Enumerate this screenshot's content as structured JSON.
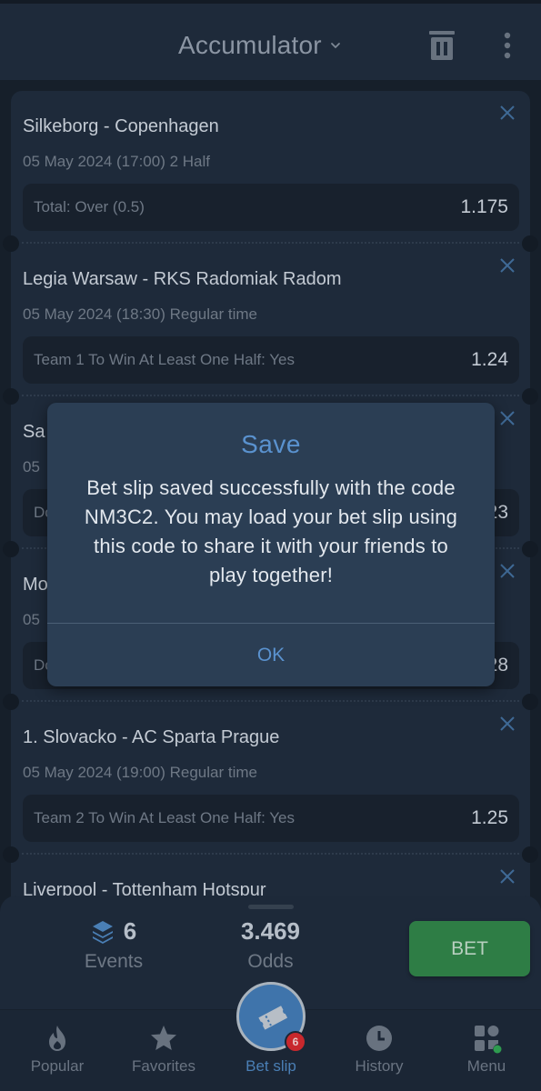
{
  "header": {
    "title": "Accumulator",
    "icons": {
      "dropdown": "chevron-down-icon",
      "delete": "trash-icon",
      "more": "more-vert-icon"
    }
  },
  "bets": [
    {
      "match": "Silkeborg - Copenhagen",
      "date": "05 May 2024 (17:00) 2 Half",
      "market": "Total: Over (0.5)",
      "odd": "1.175"
    },
    {
      "match": "Legia Warsaw - RKS Radomiak Radom",
      "date": "05 May 2024 (18:30) Regular time",
      "market": "Team 1 To Win At Least One Half: Yes",
      "odd": "1.24"
    },
    {
      "match": "Sa",
      "date": "05",
      "market": "Do",
      "odd": "23"
    },
    {
      "match": "Mo",
      "date": "05",
      "market": "Do",
      "odd": "28"
    },
    {
      "match": "1. Slovacko - AC Sparta Prague",
      "date": "05 May 2024 (19:00) Regular time",
      "market": "Team 2 To Win At Least One Half: Yes",
      "odd": "1.25"
    },
    {
      "match": "Liverpool - Tottenham Hotspur",
      "date": "",
      "market": "",
      "odd": ""
    }
  ],
  "summary": {
    "events_count": "6",
    "events_label": "Events",
    "odds_value": "3.469",
    "odds_label": "Odds",
    "bet_label": "BET"
  },
  "nav": {
    "items": [
      {
        "label": "Popular",
        "icon": "fire-icon"
      },
      {
        "label": "Favorites",
        "icon": "star-icon"
      },
      {
        "label": "Bet slip",
        "icon": "ticket-icon",
        "badge": "6"
      },
      {
        "label": "History",
        "icon": "clock-icon"
      },
      {
        "label": "Menu",
        "icon": "grid-menu-icon"
      }
    ],
    "active": "Bet slip"
  },
  "modal": {
    "title": "Save",
    "body": "Bet slip saved successfully with the code NM3C2. You may load your bet slip using this code to share it with your friends to play together!",
    "ok_label": "OK"
  },
  "colors": {
    "accent": "#5a92cf",
    "bet_button": "#2e7d45",
    "badge": "#c8282d",
    "background": "#161f2a",
    "card": "#1e2a3a"
  }
}
